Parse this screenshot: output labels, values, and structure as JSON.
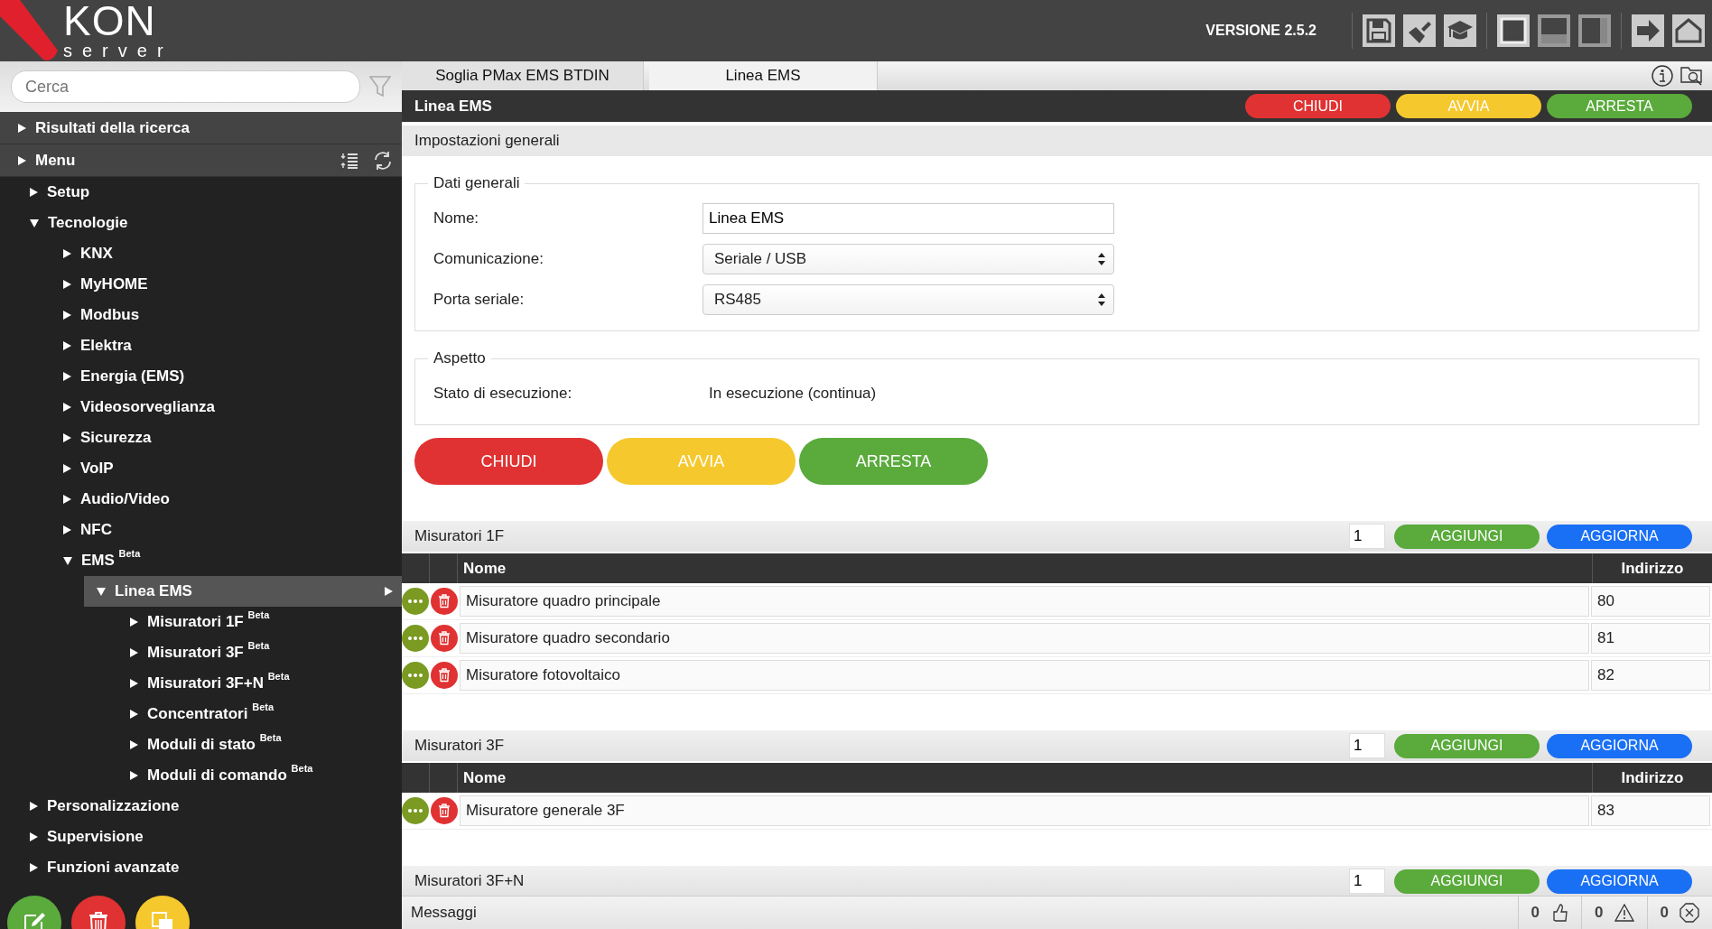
{
  "header": {
    "logo": {
      "name": "KON",
      "sub": "server"
    },
    "version": "VERSIONE 2.5.2"
  },
  "sidebar": {
    "search": {
      "placeholder": "Cerca"
    },
    "panels": [
      {
        "label": "Risultati della ricerca",
        "expanded": false
      },
      {
        "label": "Menu",
        "expanded": false
      }
    ],
    "tree": [
      {
        "label": "Setup",
        "expanded": false,
        "selected": false
      },
      {
        "label": "Tecnologie",
        "expanded": true,
        "selected": false,
        "children": [
          {
            "label": "KNX",
            "expanded": false,
            "selected": false
          },
          {
            "label": "MyHOME",
            "expanded": false,
            "selected": false
          },
          {
            "label": "Modbus",
            "expanded": false,
            "selected": false
          },
          {
            "label": "Elektra",
            "expanded": false,
            "selected": false
          },
          {
            "label": "Energia (EMS)",
            "expanded": false,
            "selected": false
          },
          {
            "label": "Videosorveglianza",
            "expanded": false,
            "selected": false
          },
          {
            "label": "Sicurezza",
            "expanded": false,
            "selected": false
          },
          {
            "label": "VoIP",
            "expanded": false,
            "selected": false
          },
          {
            "label": "Audio/Video",
            "expanded": false,
            "selected": false
          },
          {
            "label": "NFC",
            "expanded": false,
            "selected": false
          },
          {
            "label": "EMS $^{Beta}$",
            "expanded": true,
            "selected": false,
            "children": [
              {
                "label": "Linea EMS",
                "expanded": true,
                "selected": true,
                "children": [
                  {
                    "label": "Misuratori 1F $^{Beta}$",
                    "expanded": false,
                    "selected": false
                  },
                  {
                    "label": "Misuratori 3F $^{Beta}$",
                    "expanded": false,
                    "selected": false
                  },
                  {
                    "label": "Misuratori 3F+N $^{Beta}$",
                    "expanded": false,
                    "selected": false
                  },
                  {
                    "label": "Concentratori $^{Beta}$",
                    "expanded": false,
                    "selected": false
                  },
                  {
                    "label": "Moduli di stato $^{Beta}$",
                    "expanded": false,
                    "selected": false
                  },
                  {
                    "label": "Moduli di comando $^{Beta}$",
                    "expanded": false,
                    "selected": false
                  }
                ]
              }
            ]
          }
        ]
      },
      {
        "label": "Personalizzazione",
        "expanded": false,
        "selected": false
      },
      {
        "label": "Supervisione",
        "expanded": false,
        "selected": false
      },
      {
        "label": "Funzioni avanzate",
        "expanded": false,
        "selected": false
      }
    ]
  },
  "tabs": [
    {
      "label": "Soglia PMax EMS BTDIN",
      "selected": false
    },
    {
      "label": "Linea EMS",
      "selected": true
    }
  ],
  "title_bar": {
    "title": "Linea EMS",
    "buttons": [
      {
        "label": "CHIUDI",
        "kind": "red"
      },
      {
        "label": "AVVIA",
        "kind": "yellow"
      },
      {
        "label": "ARRESTA",
        "kind": "green"
      }
    ]
  },
  "settings": {
    "title": "Impostazioni generali",
    "groups": [
      {
        "legend": "Dati generali",
        "fields": [
          {
            "label": "Nome:",
            "kind": "input",
            "value": "Linea EMS"
          },
          {
            "label": "Comunicazione:",
            "kind": "select",
            "value": "Seriale / USB"
          },
          {
            "label": "Porta seriale:",
            "kind": "select",
            "value": "RS485"
          }
        ]
      },
      {
        "legend": "Aspetto",
        "fields": [
          {
            "label": "Stato di esecuzione:",
            "kind": "text",
            "value": "In esecuzione (continua)"
          }
        ]
      }
    ],
    "buttons": [
      {
        "label": "CHIUDI",
        "kind": "red"
      },
      {
        "label": "AVVIA",
        "kind": "yellow"
      },
      {
        "label": "ARRESTA",
        "kind": "green"
      }
    ]
  },
  "sections": [
    {
      "title": "Misuratori 1F",
      "count": "1",
      "add": "AGGIUNGI",
      "refresh": "AGGIORNA",
      "columns": [
        "Nome",
        "Indirizzo"
      ],
      "rows": [
        {
          "name": "Misuratore quadro principale",
          "address": "80"
        },
        {
          "name": "Misuratore quadro secondario",
          "address": "81"
        },
        {
          "name": "Misuratore fotovoltaico",
          "address": "82"
        }
      ]
    },
    {
      "title": "Misuratori 3F",
      "count": "1",
      "add": "AGGIUNGI",
      "refresh": "AGGIORNA",
      "columns": [
        "Nome",
        "Indirizzo"
      ],
      "rows": [
        {
          "name": "Misuratore generale 3F",
          "address": "83"
        }
      ]
    },
    {
      "title": "Misuratori 3F+N",
      "count": "1",
      "add": "AGGIUNGI",
      "refresh": "AGGIORNA"
    }
  ],
  "status_bar": {
    "label": "Messaggi",
    "counters": [
      {
        "kind": "ok",
        "value": "0"
      },
      {
        "kind": "warning",
        "value": "0"
      },
      {
        "kind": "error",
        "value": "0"
      }
    ]
  }
}
